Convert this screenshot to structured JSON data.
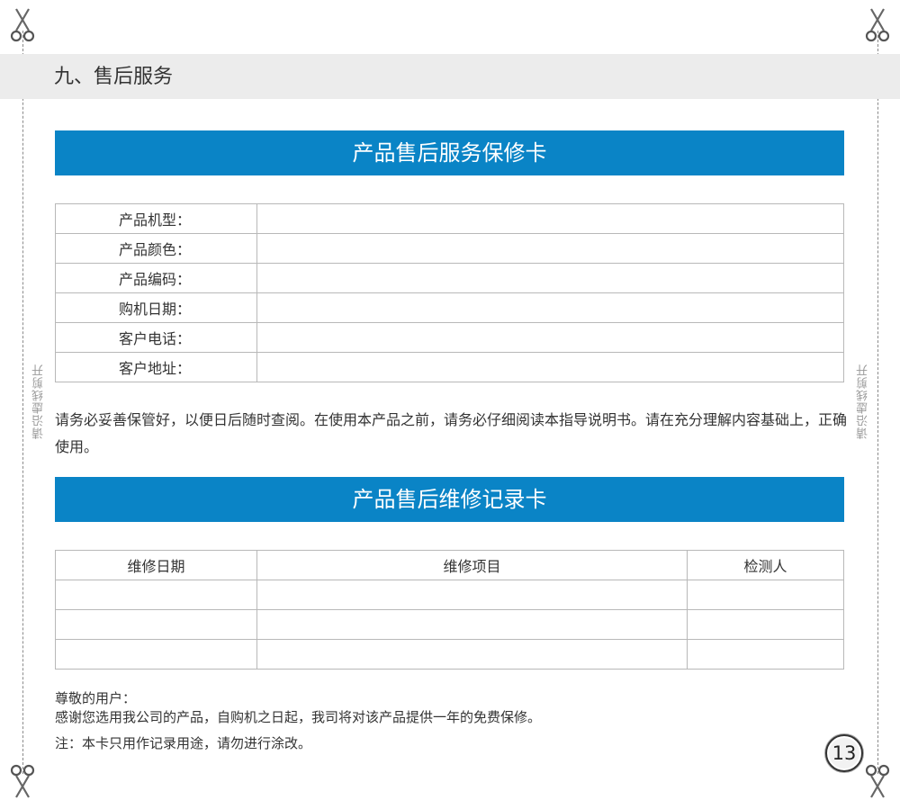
{
  "section": {
    "title": "九、售后服务"
  },
  "cut_hint": {
    "left": "请沿虚线剪开",
    "right": "请沿虚线剪开"
  },
  "warranty_card": {
    "title": "产品售后服务保修卡",
    "fields": [
      {
        "label": "产品机型：",
        "value": ""
      },
      {
        "label": "产品颜色：",
        "value": ""
      },
      {
        "label": "产品编码：",
        "value": ""
      },
      {
        "label": "购机日期：",
        "value": ""
      },
      {
        "label": "客户电话：",
        "value": ""
      },
      {
        "label": "客户地址：",
        "value": ""
      }
    ]
  },
  "instruction": "请务必妥善保管好，以便日后随时查阅。在使用本产品之前，请务必仔细阅读本指导说明书。请在充分理解内容基础上，正确使用。",
  "repair_card": {
    "title": "产品售后维修记录卡",
    "headers": [
      "维修日期",
      "维修项目",
      "检测人"
    ],
    "rows": [
      [
        "",
        "",
        ""
      ],
      [
        "",
        "",
        ""
      ],
      [
        "",
        "",
        ""
      ]
    ]
  },
  "notes": {
    "greeting": "尊敬的用户：",
    "thanks": "感谢您选用我公司的产品，自购机之日起，我司将对该产品提供一年的免费保修。",
    "note": "注：本卡只用作记录用途，请勿进行涂改。"
  },
  "page_number": "13",
  "icons": {
    "scissors": "scissors-icon"
  }
}
